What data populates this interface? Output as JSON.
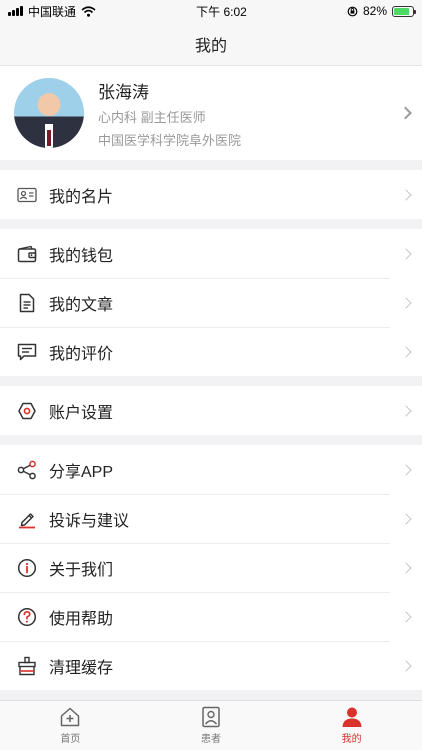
{
  "status": {
    "carrier": "中国联通",
    "time": "下午 6:02",
    "battery": "82%",
    "battery_level": 0.82
  },
  "nav": {
    "title": "我的"
  },
  "profile": {
    "name": "张海涛",
    "dept_title": "心内科  副主任医师",
    "hospital": "中国医学科学院阜外医院"
  },
  "sections": [
    [
      {
        "label": "我的名片",
        "icon": "business-card-icon"
      }
    ],
    [
      {
        "label": "我的钱包",
        "icon": "wallet-icon"
      },
      {
        "label": "我的文章",
        "icon": "article-icon"
      },
      {
        "label": "我的评价",
        "icon": "comment-icon"
      }
    ],
    [
      {
        "label": "账户设置",
        "icon": "settings-icon"
      }
    ],
    [
      {
        "label": "分享APP",
        "icon": "share-icon"
      },
      {
        "label": "投诉与建议",
        "icon": "feedback-pen-icon"
      },
      {
        "label": "关于我们",
        "icon": "info-icon"
      },
      {
        "label": "使用帮助",
        "icon": "help-icon"
      },
      {
        "label": "清理缓存",
        "icon": "clear-cache-icon"
      }
    ]
  ],
  "tabs": [
    {
      "label": "首页",
      "icon": "home-icon"
    },
    {
      "label": "患者",
      "icon": "patient-icon"
    },
    {
      "label": "我的",
      "icon": "profile-icon"
    }
  ],
  "colors": {
    "accent": "#d9312b",
    "icon": "#333333"
  }
}
